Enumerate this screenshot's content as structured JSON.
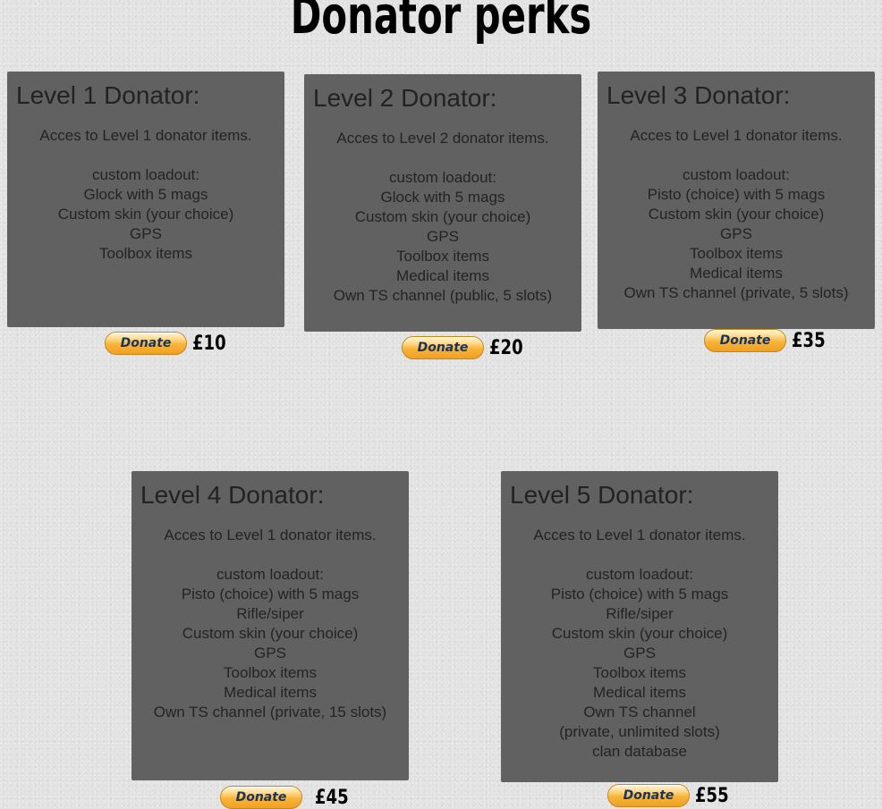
{
  "page": {
    "title": "Donator perks"
  },
  "donate_label": "Donate",
  "levels": [
    {
      "title": "Level 1 Donator:",
      "intro": "Acces to Level 1 donator items.",
      "lines": [
        "custom loadout:",
        "Glock with 5 mags",
        "Custom skin (your choice)",
        "GPS",
        "Toolbox items"
      ],
      "price": "£10"
    },
    {
      "title": "Level 2 Donator:",
      "intro": "Acces to Level 2 donator items.",
      "lines": [
        "custom loadout:",
        "Glock with 5 mags",
        "Custom skin (your choice)",
        "GPS",
        "Toolbox items",
        "Medical items",
        "Own TS channel (public, 5 slots)"
      ],
      "price": "£20"
    },
    {
      "title": "Level 3 Donator:",
      "intro": "Acces to Level 1 donator items.",
      "lines": [
        "custom loadout:",
        "Pisto (choice) with 5 mags",
        "Custom skin (your choice)",
        "GPS",
        "Toolbox items",
        "Medical items",
        "Own TS channel (private, 5 slots)"
      ],
      "price": "£35"
    },
    {
      "title": "Level 4 Donator:",
      "intro": "Acces to Level 1 donator items.",
      "lines": [
        "custom loadout:",
        "Pisto (choice) with 5 mags",
        "Rifle/siper",
        "Custom skin (your choice)",
        "GPS",
        "Toolbox items",
        "Medical items",
        "Own TS channel (private, 15 slots)"
      ],
      "price": "£45"
    },
    {
      "title": "Level 5 Donator:",
      "intro": "Acces to Level 1 donator items.",
      "lines": [
        "custom loadout:",
        "Pisto (choice) with 5 mags",
        "Rifle/siper",
        "Custom skin (your choice)",
        "GPS",
        "Toolbox items",
        "Medical items",
        "Own TS channel",
        "(private, unlimited slots)",
        "clan database"
      ],
      "price": "£55"
    }
  ],
  "colors": {
    "card_background": "#616161",
    "page_background": "#e2e2e2",
    "donate_button": "#f7b53a"
  }
}
